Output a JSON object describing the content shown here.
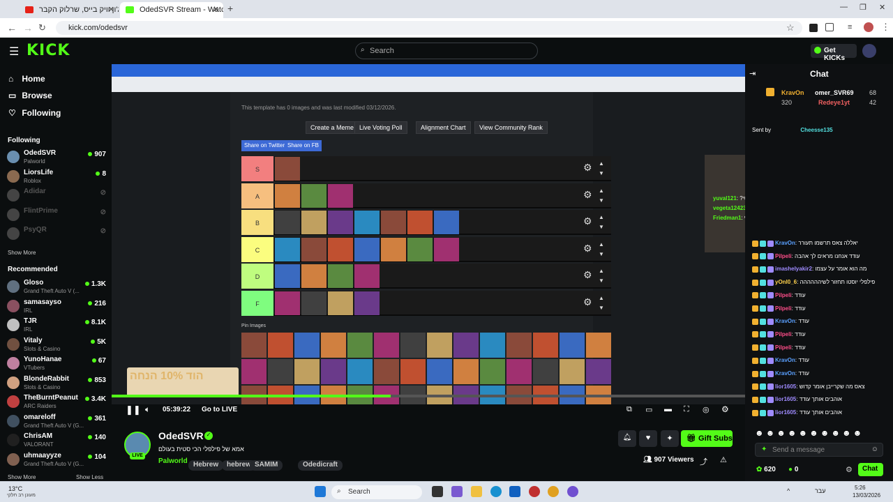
{
  "browser": {
    "tabs": [
      {
        "label": "ג'ון וויק בייס, שרלוק הקבר"
      },
      {
        "label": "OdedSVR Stream - Watch L"
      }
    ],
    "url": "kick.com/odedsvr"
  },
  "header": {
    "logo": "KICK",
    "search_placeholder": "Search",
    "get_kicks": "Get KICKs"
  },
  "sidebar": {
    "nav": [
      {
        "label": "Home"
      },
      {
        "label": "Browse"
      },
      {
        "label": "Following"
      }
    ],
    "following_title": "Following",
    "following": [
      {
        "name": "OdedSVR",
        "category": "Palworld",
        "viewers": "907",
        "color": "#6a8fb0"
      },
      {
        "name": "LiorsLife",
        "category": "Roblox",
        "viewers": "8",
        "color": "#8a6a50"
      },
      {
        "name": "Adidar",
        "category": "",
        "viewers": "",
        "color": "#444"
      },
      {
        "name": "FlintPrime",
        "category": "",
        "viewers": "",
        "color": "#444"
      },
      {
        "name": "PsyQR",
        "category": "",
        "viewers": "",
        "color": "#444"
      }
    ],
    "show_more": "Show More",
    "recommended_title": "Recommended",
    "recommended": [
      {
        "name": "Gloso",
        "category": "Grand Theft Auto V (...",
        "viewers": "1.3K",
        "color": "#607080"
      },
      {
        "name": "samasayso",
        "category": "IRL",
        "viewers": "216",
        "color": "#8a5060"
      },
      {
        "name": "TJR",
        "category": "IRL",
        "viewers": "8.1K",
        "color": "#c0c0c0"
      },
      {
        "name": "Vitaly",
        "category": "Slots & Casino",
        "viewers": "5K",
        "color": "#705040"
      },
      {
        "name": "YunoHanae",
        "category": "VTubers",
        "viewers": "67",
        "color": "#c080a0"
      },
      {
        "name": "BlondeRabbit",
        "category": "Slots & Casino",
        "viewers": "853",
        "color": "#d0a080"
      },
      {
        "name": "TheBurntPeanut",
        "category": "ARC Raiders",
        "viewers": "3.4K",
        "color": "#c04040"
      },
      {
        "name": "omareloff",
        "category": "Grand Theft Auto V (G...",
        "viewers": "361",
        "color": "#405060"
      },
      {
        "name": "ChrisAM",
        "category": "VALORANT",
        "viewers": "140",
        "color": "#202020"
      },
      {
        "name": "uhmaayyze",
        "category": "Grand Theft Auto V (G...",
        "viewers": "104",
        "color": "#806050"
      }
    ],
    "show_more_bottom": "Show More",
    "show_less": "Show Less"
  },
  "video": {
    "tier_buttons": [
      "Create a Meme",
      "Live Voting Poll",
      "Alignment Chart",
      "View Community Rank"
    ],
    "share_buttons": [
      "Share on Twitter",
      "Share on FB"
    ],
    "template_note": "This template has 0 images and was last modified 03/12/2026.",
    "tiers": [
      {
        "label": "S",
        "color": "#f27f7f",
        "count": 1
      },
      {
        "label": "A",
        "color": "#f6bf7f",
        "count": 3
      },
      {
        "label": "B",
        "color": "#f8df7f",
        "count": 7
      },
      {
        "label": "C",
        "color": "#fbfd7f",
        "count": 7
      },
      {
        "label": "D",
        "color": "#bffd7f",
        "count": 4
      },
      {
        "label": "F",
        "color": "#7ffd7f",
        "count": 4
      }
    ],
    "pin_label": "Pin Images",
    "overlay_chat": [
      {
        "user": "yuval121",
        "text": "?דה כהן מעל בוטי",
        "color": "#53fc18"
      },
      {
        "user": "vegeta1242352",
        "text": "פייה תוסף פלסטיק",
        "color": "#53fc18"
      },
      {
        "user": "Friedman1",
        "text": "פייה מתחת לזברה של גל כהן זה סירוף",
        "color": "#53fc18"
      }
    ],
    "promo": "הוד 10% הנחה",
    "time": "05:39:22",
    "go_live": "Go to LIVE",
    "progress": 0.44
  },
  "channel": {
    "name": "OdedSVR",
    "title": "אמא של פילפלי הכי סטית בעולם",
    "category": "Palworld",
    "tags": [
      "Hebrew",
      "hebrew",
      "SAMIM",
      "Odedicraft"
    ],
    "viewers": "907 Viewers",
    "gift_subs": "Gift Subs",
    "live_badge": "LIVE"
  },
  "chat": {
    "title": "Chat",
    "leaders": [
      {
        "name": "KravOn",
        "value": "320"
      },
      {
        "name": "omer_SVR69",
        "value": "68"
      },
      {
        "name": "Redeye1yt",
        "value": "42"
      }
    ],
    "sent_by": "Sent by",
    "sent_user": "Cheesse135",
    "messages": [
      {
        "user": "KravOn",
        "text": "יאללה צאס תרשמו תעורר",
        "color": "#5aa0ff"
      },
      {
        "user": "Pilpeli",
        "text": "עודד אנחנו מראים לך אהבה",
        "color": "#ff4d88"
      },
      {
        "user": "imashelyakir2",
        "text": "מה הוא אומר על עצמו",
        "color": "#9f8bff"
      },
      {
        "user": "yOnI0_6",
        "text": "פילפלי יוסטו תחזור לשיהההההה",
        "color": "#ffd24d"
      },
      {
        "user": "Pilpeli",
        "text": "עודד",
        "color": "#ff4d88"
      },
      {
        "user": "Pilpeli",
        "text": "עודד",
        "color": "#ff4d88"
      },
      {
        "user": "KravOn",
        "text": "עודד",
        "color": "#5aa0ff"
      },
      {
        "user": "Pilpeli",
        "text": "עודד",
        "color": "#ff4d88"
      },
      {
        "user": "Pilpeli",
        "text": "עודד",
        "color": "#ff4d88"
      },
      {
        "user": "KravOn",
        "text": "עודד",
        "color": "#5aa0ff"
      },
      {
        "user": "KravOn",
        "text": "עודד",
        "color": "#5aa0ff"
      },
      {
        "user": "lior1605",
        "text": "צאס מה שקרייבן אומר קדוש",
        "color": "#9f8bff"
      },
      {
        "user": "lior1605",
        "text": "אוהבים אותך עודד",
        "color": "#9f8bff"
      },
      {
        "user": "lior1605",
        "text": "אוהבים אותך עודד",
        "color": "#9f8bff"
      }
    ],
    "input_placeholder": "Send a message",
    "points": "620",
    "zero": "0",
    "chat_button": "Chat"
  },
  "taskbar": {
    "weather_temp": "13°C",
    "weather_text": "מעונן רב חלקי",
    "search": "Search",
    "lang": "עבר",
    "time": "5:26",
    "date": "13/03/2026"
  }
}
